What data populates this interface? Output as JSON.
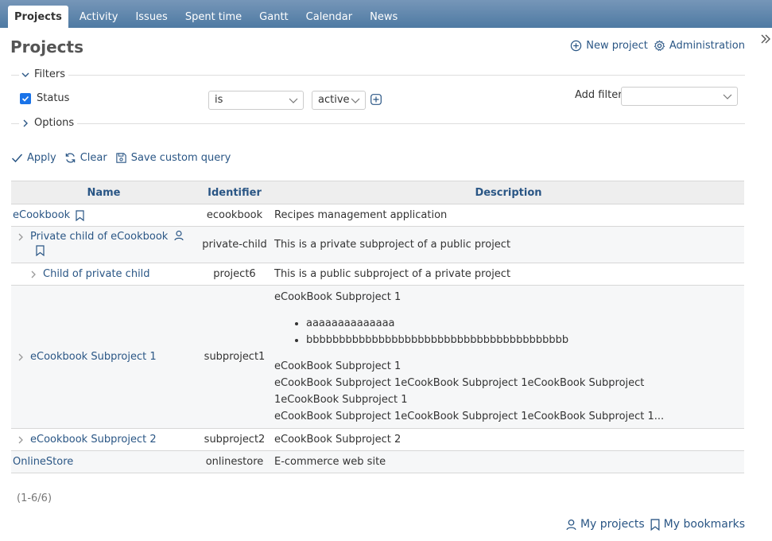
{
  "tabs": [
    {
      "label": "Projects",
      "active": true
    },
    {
      "label": "Activity"
    },
    {
      "label": "Issues"
    },
    {
      "label": "Spent time"
    },
    {
      "label": "Gantt"
    },
    {
      "label": "Calendar"
    },
    {
      "label": "News"
    }
  ],
  "page": {
    "title": "Projects",
    "new_project": "New project",
    "administration": "Administration"
  },
  "filters": {
    "legend": "Filters",
    "status_label": "Status",
    "operator": "is",
    "value": "active",
    "add_filter_label": "Add filter",
    "add_filter_value": ""
  },
  "options": {
    "legend": "Options"
  },
  "query": {
    "apply": "Apply",
    "clear": "Clear",
    "save": "Save custom query"
  },
  "table": {
    "headers": {
      "name": "Name",
      "identifier": "Identifier",
      "description": "Description"
    },
    "rows": [
      {
        "name": "eCookbook",
        "identifier": "ecookbook",
        "description": "Recipes management application"
      },
      {
        "name": "Private child of eCookbook",
        "identifier": "private-child",
        "description": "This is a private subproject of a public project"
      },
      {
        "name": "Child of private child",
        "identifier": "project6",
        "description": "This is a public subproject of a private project"
      },
      {
        "name": "eCookbook Subproject 1",
        "identifier": "subproject1",
        "description": {
          "p1": "eCookBook Subproject 1",
          "list": [
            "aaaaaaaaaaaaaa",
            "bbbbbbbbbbbbbbbbbbbbbbbbbbbbbbbbbbbbbbbb"
          ],
          "p2": "eCookBook Subproject 1",
          "p3": "eCookBook Subproject 1eCookBook Subproject 1eCookBook Subproject 1eCookBook Subproject 1",
          "p4": "eCookBook Subproject 1eCookBook Subproject 1eCookBook Subproject 1..."
        }
      },
      {
        "name": "eCookbook Subproject 2",
        "identifier": "subproject2",
        "description": "eCookBook Subproject 2"
      },
      {
        "name": "OnlineStore",
        "identifier": "onlinestore",
        "description": "E-commerce web site"
      }
    ]
  },
  "pagination": "(1-6/6)",
  "footer": {
    "my_projects": "My projects",
    "my_bookmarks": "My bookmarks"
  },
  "colors": {
    "link": "#2a5685",
    "header_bar": "#628db6",
    "checkbox": "#1a73e8"
  }
}
